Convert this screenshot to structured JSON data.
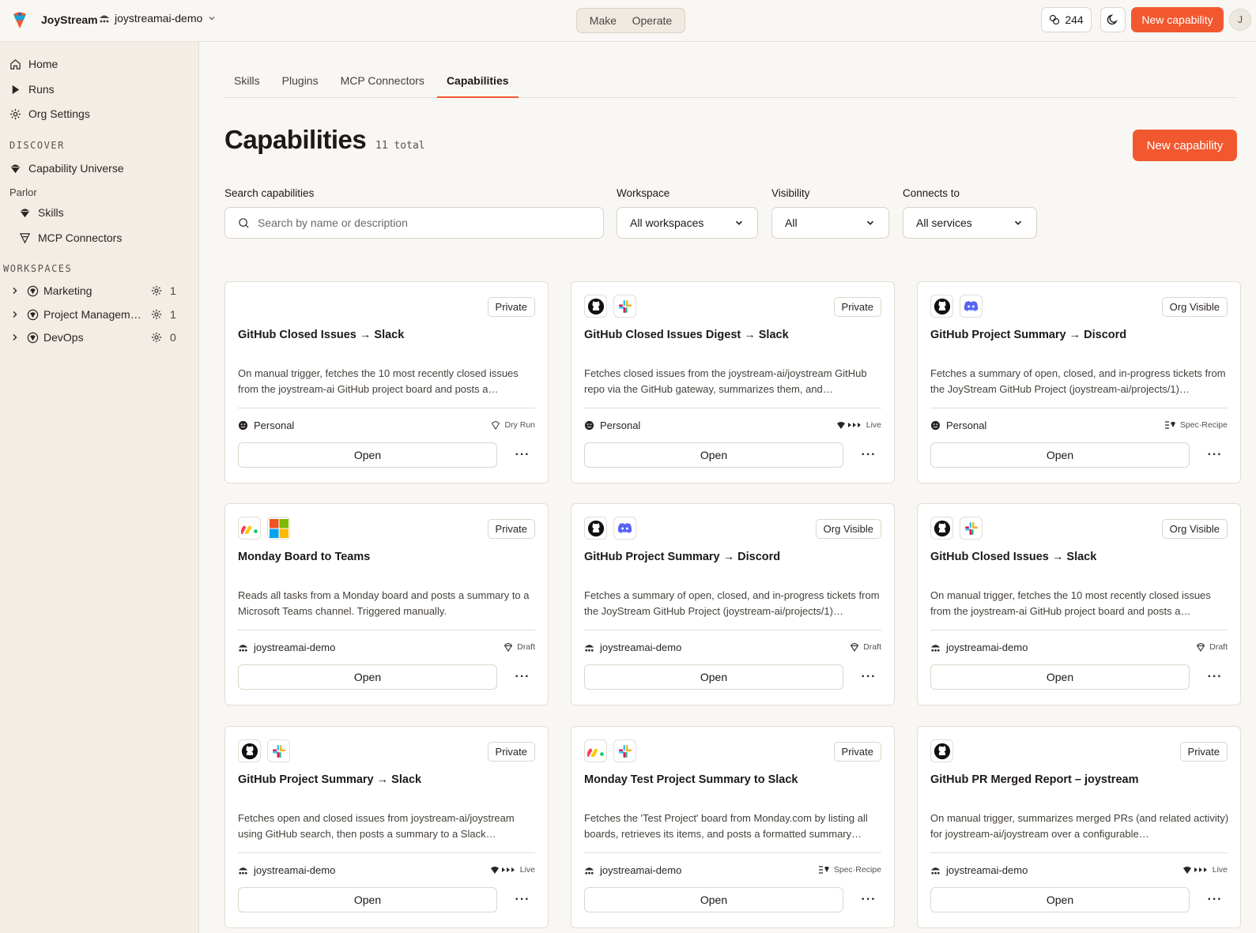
{
  "topbar": {
    "brand": "JoyStream",
    "org": "joystreamai-demo",
    "modes": [
      "Make",
      "Operate"
    ],
    "credits": "244",
    "new_button": "New capability",
    "avatar_initial": "J"
  },
  "sidebar": {
    "nav": [
      {
        "label": "Home",
        "icon": "home-icon"
      },
      {
        "label": "Runs",
        "icon": "play-icon"
      },
      {
        "label": "Org Settings",
        "icon": "gear-icon"
      }
    ],
    "discover_label": "DISCOVER",
    "capability_universe": "Capability Universe",
    "parlor_label": "Parlor",
    "parlor_items": [
      "Skills",
      "MCP Connectors"
    ],
    "workspaces_label": "WORKSPACES",
    "workspaces": [
      {
        "name": "Marketing",
        "count": "1"
      },
      {
        "name": "Project Manageme...",
        "count": "1"
      },
      {
        "name": "DevOps",
        "count": "0"
      }
    ]
  },
  "tabs": [
    "Skills",
    "Plugins",
    "MCP Connectors",
    "Capabilities"
  ],
  "active_tab": "Capabilities",
  "page": {
    "title": "Capabilities",
    "total": "11 total",
    "new_button": "New capability"
  },
  "filters": {
    "search_label": "Search capabilities",
    "search_placeholder": "Search by name or description",
    "workspace_label": "Workspace",
    "workspace_value": "All workspaces",
    "visibility_label": "Visibility",
    "visibility_value": "All",
    "connects_label": "Connects to",
    "connects_value": "All services"
  },
  "cards": [
    {
      "services": [],
      "visibility": "Private",
      "title": "GitHub Closed Issues → Slack",
      "description": "On manual trigger, fetches the 10 most recently closed issues from the joystream-ai GitHub project board and posts a…",
      "owner": "Personal",
      "owner_icon": "smiley-icon",
      "status": "Dry Run",
      "status_icon": "shield-icon",
      "open": "Open"
    },
    {
      "services": [
        "github",
        "slack"
      ],
      "visibility": "Private",
      "title": "GitHub Closed Issues Digest → Slack",
      "description": "Fetches closed issues from the joystream-ai/joystream GitHub repo via the GitHub gateway, summarizes them, and…",
      "owner": "Personal",
      "owner_icon": "smiley-icon",
      "status": "Live",
      "status_icon": "live-icon",
      "open": "Open"
    },
    {
      "services": [
        "github",
        "discord"
      ],
      "visibility": "Org Visible",
      "title": "GitHub Project Summary → Discord",
      "description": "Fetches a summary of open, closed, and in-progress tickets from the JoyStream GitHub Project (joystream-ai/projects/1)…",
      "owner": "Personal",
      "owner_icon": "smiley-icon",
      "status": "Spec·Recipe",
      "status_icon": "recipe-icon",
      "open": "Open"
    },
    {
      "services": [
        "monday",
        "teams"
      ],
      "visibility": "Private",
      "title": "Monday Board to Teams",
      "description": "Reads all tasks from a Monday board and posts a summary to a Microsoft Teams channel. Triggered manually.",
      "owner": "joystreamai-demo",
      "owner_icon": "org-icon",
      "status": "Draft",
      "status_icon": "draft-icon",
      "open": "Open"
    },
    {
      "services": [
        "github",
        "discord"
      ],
      "visibility": "Org Visible",
      "title": "GitHub Project Summary → Discord",
      "description": "Fetches a summary of open, closed, and in-progress tickets from the JoyStream GitHub Project (joystream-ai/projects/1)…",
      "owner": "joystreamai-demo",
      "owner_icon": "org-icon",
      "status": "Draft",
      "status_icon": "draft-icon",
      "open": "Open"
    },
    {
      "services": [
        "github",
        "slack"
      ],
      "visibility": "Org Visible",
      "title": "GitHub Closed Issues → Slack",
      "description": "On manual trigger, fetches the 10 most recently closed issues from the joystream-ai GitHub project board and posts a…",
      "owner": "joystreamai-demo",
      "owner_icon": "org-icon",
      "status": "Draft",
      "status_icon": "draft-icon",
      "open": "Open"
    },
    {
      "services": [
        "github",
        "slack"
      ],
      "visibility": "Private",
      "title": "GitHub Project Summary → Slack",
      "description": "Fetches open and closed issues from joystream-ai/joystream using GitHub search, then posts a summary to a Slack…",
      "owner": "joystreamai-demo",
      "owner_icon": "org-icon",
      "status": "Live",
      "status_icon": "live-icon",
      "open": "Open"
    },
    {
      "services": [
        "monday",
        "slack"
      ],
      "visibility": "Private",
      "title": "Monday Test Project Summary to Slack",
      "description": "Fetches the 'Test Project' board from Monday.com by listing all boards, retrieves its items, and posts a formatted summary…",
      "owner": "joystreamai-demo",
      "owner_icon": "org-icon",
      "status": "Spec·Recipe",
      "status_icon": "recipe-icon",
      "open": "Open"
    },
    {
      "services": [
        "github"
      ],
      "visibility": "Private",
      "title": "GitHub PR Merged Report – joystream",
      "description": "On manual trigger, summarizes merged PRs (and related activity) for joystream-ai/joystream over a configurable…",
      "owner": "joystreamai-demo",
      "owner_icon": "org-icon",
      "status": "Live",
      "status_icon": "live-icon",
      "open": "Open"
    }
  ],
  "colors": {
    "accent": "#f2582f",
    "background": "#f9f7f3",
    "sidebar": "#f3ede6",
    "border": "#e4ddd3"
  }
}
